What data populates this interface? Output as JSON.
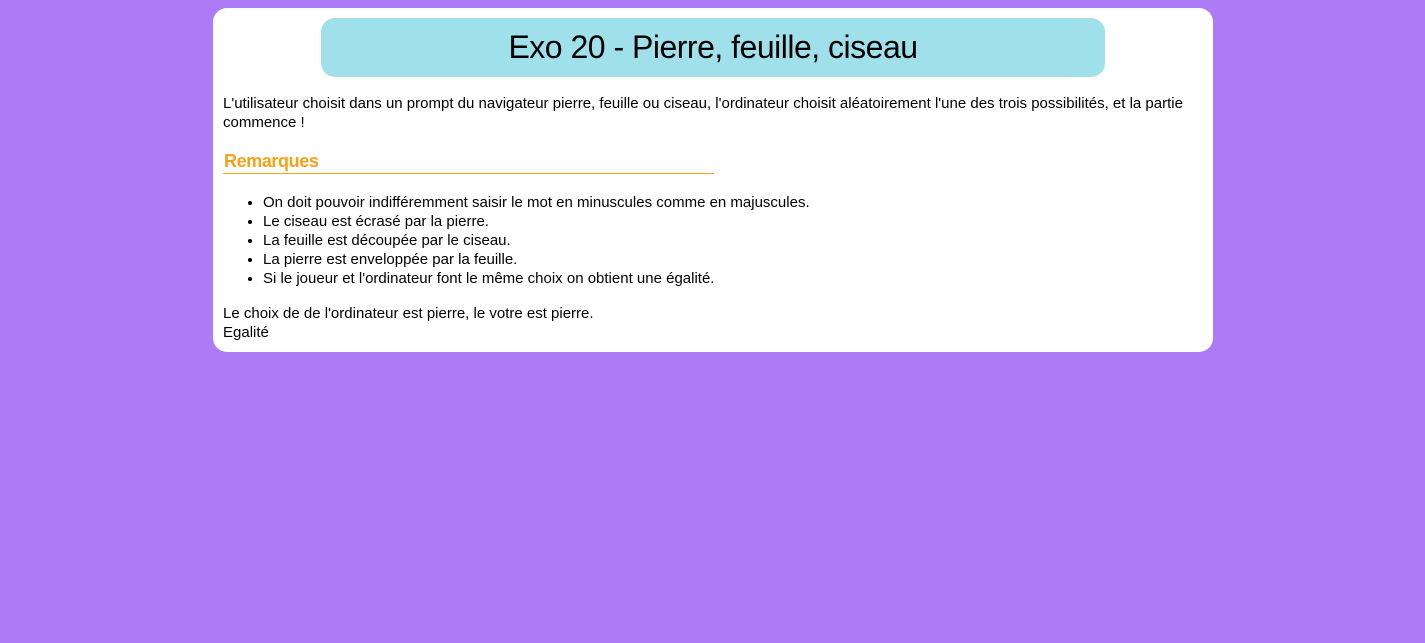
{
  "page": {
    "background_color": "#ad7bf5",
    "card_color": "#ffffff",
    "title_bg_color": "#9fe0eb",
    "accent_color": "#f5a21b"
  },
  "header": {
    "title": "Exo 20 - Pierre, feuille, ciseau"
  },
  "intro": {
    "text": "L'utilisateur choisit dans un prompt du navigateur pierre, feuille ou ciseau, l'ordinateur choisit aléatoirement l'une des trois possibilités, et la partie commence !"
  },
  "remarques": {
    "heading": "Remarques",
    "items": [
      "On doit pouvoir indifféremment saisir le mot en minuscules comme en majuscules.",
      "Le ciseau est écrasé par la pierre.",
      "La feuille est découpée par le ciseau.",
      "La pierre est enveloppée par la feuille.",
      "Si le joueur et l'ordinateur font le même choix on obtient une égalité."
    ]
  },
  "result": {
    "line1": "Le choix de de l'ordinateur est pierre, le votre est pierre.",
    "line2": "Egalité"
  }
}
